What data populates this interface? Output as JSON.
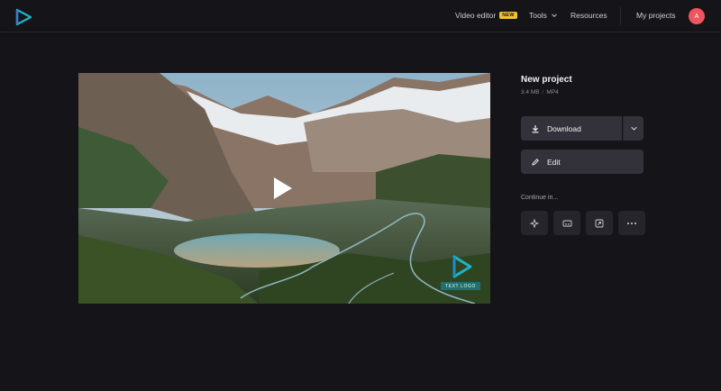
{
  "nav": {
    "video_editor": "Video editor",
    "new_badge": "NEW",
    "tools": "Tools",
    "resources": "Resources",
    "my_projects": "My projects",
    "avatar_initial": "A"
  },
  "video": {
    "watermark_text": "TEXT LOGO"
  },
  "project": {
    "title": "New project",
    "size": "3.4 MB",
    "separator": "/",
    "format": "MP4",
    "download_label": "Download",
    "edit_label": "Edit",
    "continue_label": "Continue in..."
  },
  "tools": [
    {
      "icon": "sparkle-icon"
    },
    {
      "icon": "subtitles-icon"
    },
    {
      "icon": "resize-icon"
    },
    {
      "icon": "more-icon"
    }
  ],
  "colors": {
    "background": "#151419",
    "button": "#33323a",
    "brand": "#1fb2c4",
    "badge": "#f2c12e",
    "avatar": "#f0545e"
  }
}
